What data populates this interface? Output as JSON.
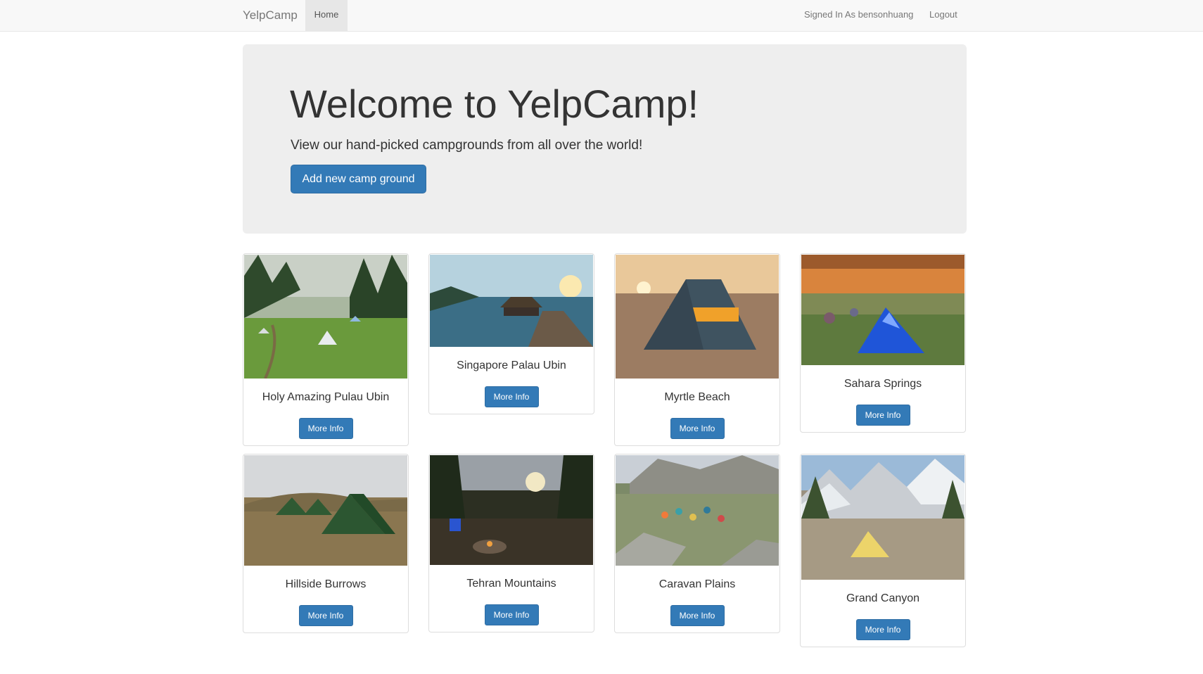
{
  "nav": {
    "brand": "YelpCamp",
    "home": "Home",
    "user": "Signed In As bensonhuang",
    "logout": "Logout"
  },
  "jumbotron": {
    "title": "Welcome to YelpCamp!",
    "subtitle": "View our hand-picked campgrounds from all over the world!",
    "add_button": "Add new camp ground"
  },
  "campgrounds": [
    {
      "name": "Holy Amazing Pulau Ubin",
      "button": "More Info",
      "image": "forest-meadow-tents-photo"
    },
    {
      "name": "Singapore Palau Ubin",
      "button": "More Info",
      "image": "jetty-sunset-photo"
    },
    {
      "name": "Myrtle Beach",
      "button": "More Info",
      "image": "beach-tent-sunset-photo"
    },
    {
      "name": "Sahara Springs",
      "button": "More Info",
      "image": "blue-tent-sunset-photo"
    },
    {
      "name": "Hillside Burrows",
      "button": "More Info",
      "image": "green-tents-hillside-photo"
    },
    {
      "name": "Tehran Mountains",
      "button": "More Info",
      "image": "campfire-forest-photo"
    },
    {
      "name": "Caravan Plains",
      "button": "More Info",
      "image": "rocky-valley-tents-photo"
    },
    {
      "name": "Grand Canyon",
      "button": "More Info",
      "image": "mountain-tent-photo"
    }
  ]
}
